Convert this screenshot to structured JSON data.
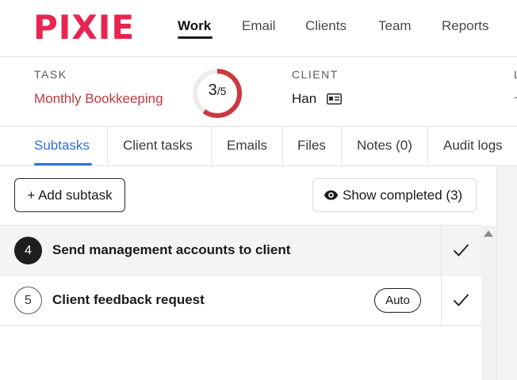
{
  "brand": {
    "logo": "PIXIE",
    "accent": "#e8244f"
  },
  "nav": {
    "items": [
      {
        "label": "Work",
        "active": true
      },
      {
        "label": "Email",
        "active": false
      },
      {
        "label": "Clients",
        "active": false
      },
      {
        "label": "Team",
        "active": false
      },
      {
        "label": "Reports",
        "active": false
      }
    ]
  },
  "task": {
    "task_label": "TASK",
    "task_name": "Monthly Bookkeeping",
    "progress": {
      "done": "3",
      "slash_total": "/5",
      "fraction": 0.6,
      "color": "#c9393f"
    },
    "client_label": "CLIENT",
    "client_name": "Han",
    "client_icon": "contact-card-icon",
    "clipped_label": "L",
    "clipped_value": "-"
  },
  "subtabs": [
    {
      "label": "Subtasks",
      "active": true
    },
    {
      "label": "Client tasks",
      "active": false
    },
    {
      "label": "Emails",
      "active": false
    },
    {
      "label": "Files",
      "active": false
    },
    {
      "label": "Notes (0)",
      "active": false
    },
    {
      "label": "Audit logs",
      "active": false
    }
  ],
  "toolbar": {
    "add_label": "+ Add subtask",
    "show_completed_label": "Show completed (3)",
    "show_icon": "eye-icon"
  },
  "subtasks": [
    {
      "number": "4",
      "title": "Send management accounts to client",
      "badge": "",
      "state": "current"
    },
    {
      "number": "5",
      "title": "Client feedback request",
      "badge": "Auto",
      "state": "pending"
    }
  ],
  "colors": {
    "active_tab": "#2f6fdd",
    "task_name": "#c0383f"
  }
}
